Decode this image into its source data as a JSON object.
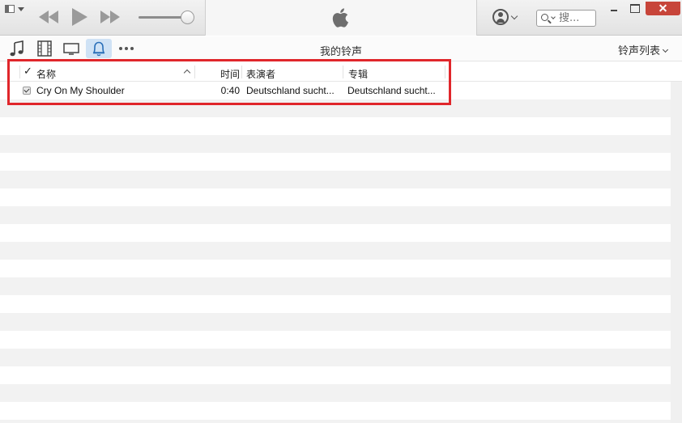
{
  "toolbar": {
    "search_placeholder": "搜...",
    "colors": {
      "close": "#c7453a",
      "accent_tab": "#cfe2f5",
      "highlight": "#e0262b"
    }
  },
  "navbar": {
    "page_title": "我的铃声",
    "list_dropdown_label": "铃声列表",
    "media_icons": [
      "music-note-icon",
      "film-icon",
      "tv-icon",
      "bell-icon",
      "more-icon"
    ]
  },
  "table": {
    "columns": {
      "check": "✓",
      "name": "名称",
      "time": "时间",
      "artist": "表演者",
      "album": "专辑"
    },
    "rows": [
      {
        "checked": true,
        "name": "Cry On My Shoulder",
        "time": "0:40",
        "artist": "Deutschland sucht...",
        "album": "Deutschland sucht..."
      }
    ]
  }
}
